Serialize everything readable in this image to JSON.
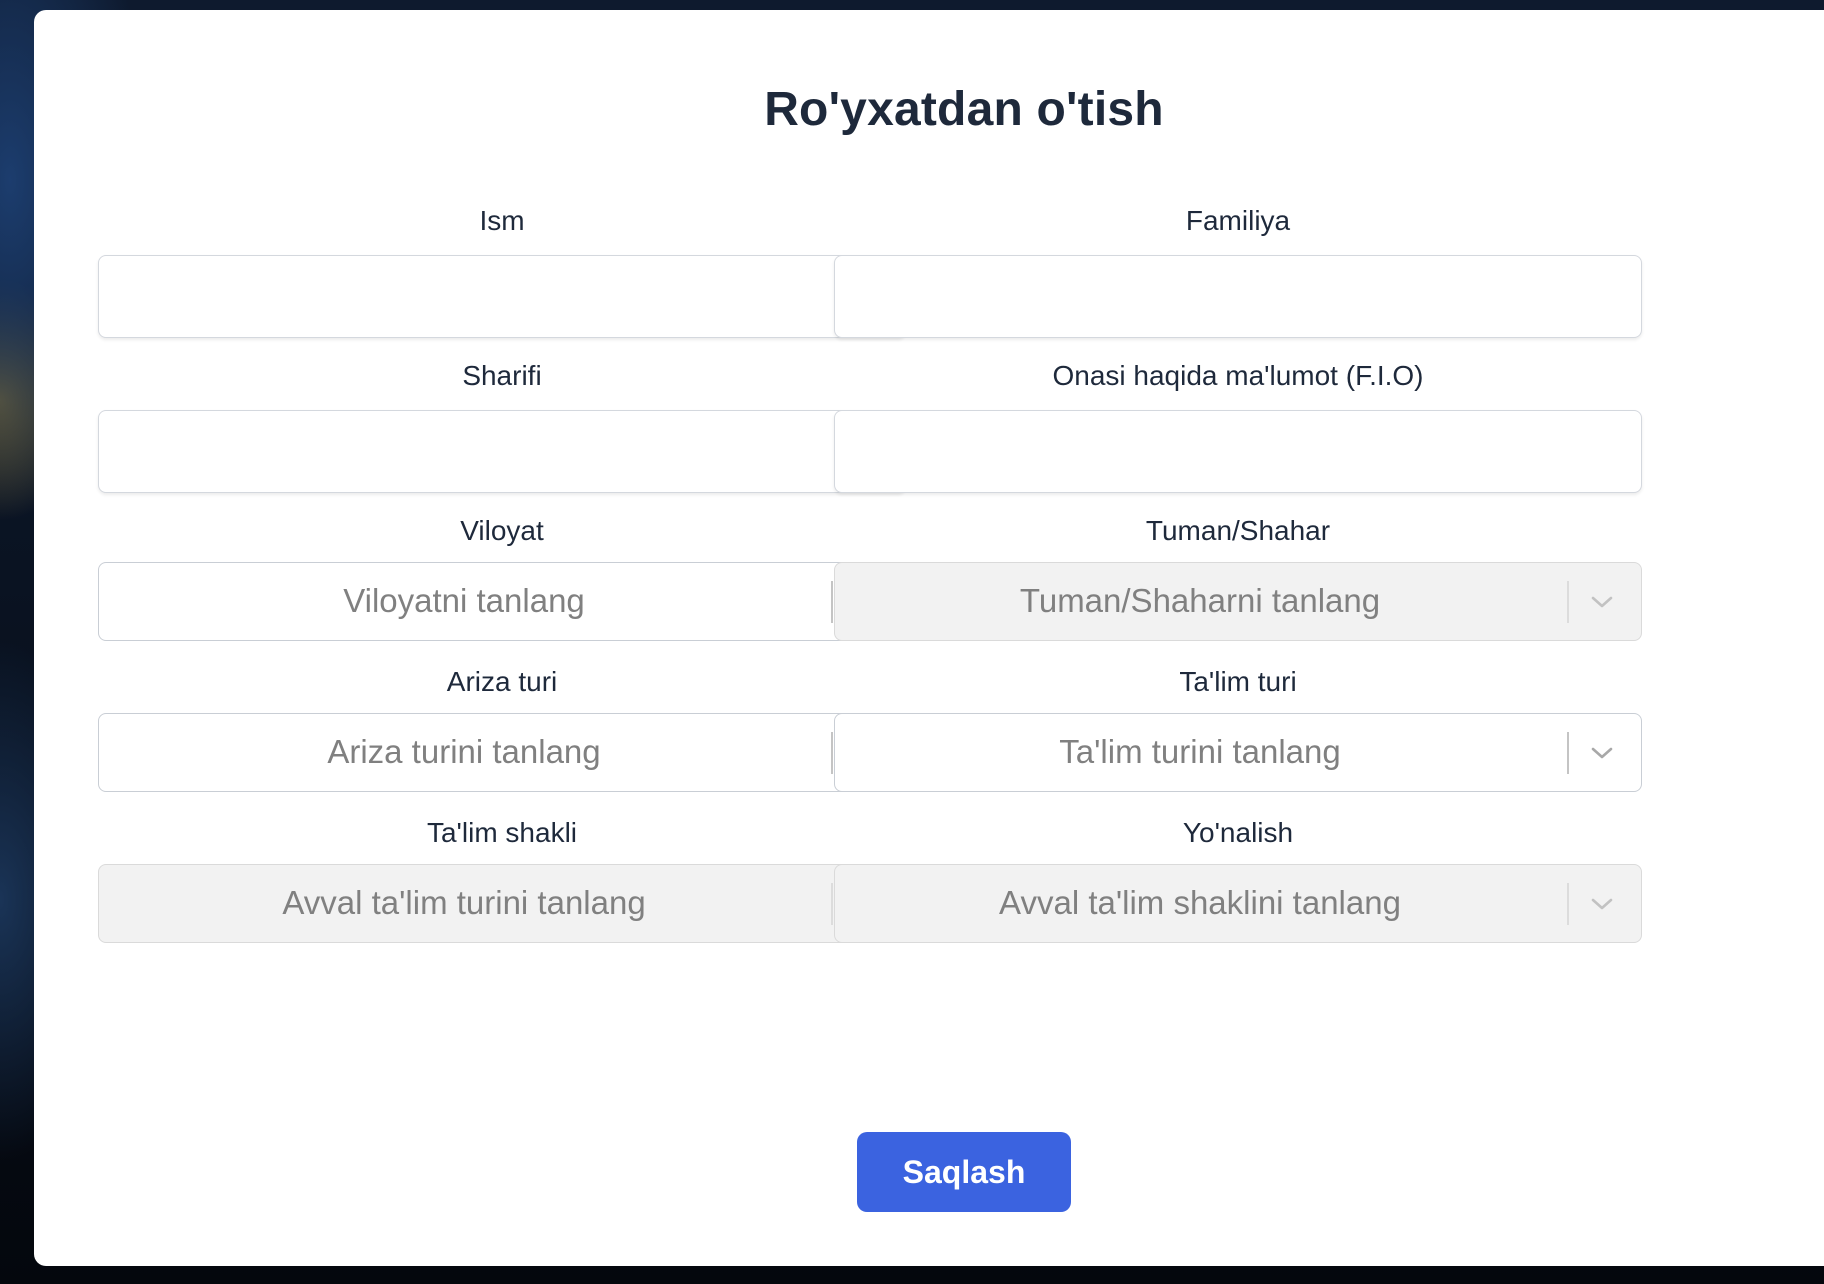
{
  "form": {
    "title": "Ro'yxatdan o'tish",
    "fields": {
      "ism": {
        "label": "Ism",
        "value": ""
      },
      "familiya": {
        "label": "Familiya",
        "value": ""
      },
      "sharifi": {
        "label": "Sharifi",
        "value": ""
      },
      "onasi": {
        "label": "Onasi haqida ma'lumot (F.I.O)",
        "value": ""
      }
    },
    "selects": {
      "viloyat": {
        "label": "Viloyat",
        "placeholder": "Viloyatni tanlang",
        "disabled": false
      },
      "tuman": {
        "label": "Tuman/Shahar",
        "placeholder": "Tuman/Shaharni tanlang",
        "disabled": true
      },
      "ariza": {
        "label": "Ariza turi",
        "placeholder": "Ariza turini tanlang",
        "disabled": false
      },
      "talim_turi": {
        "label": "Ta'lim turi",
        "placeholder": "Ta'lim turini tanlang",
        "disabled": false
      },
      "talim_shakli": {
        "label": "Ta'lim shakli",
        "placeholder": "Avval ta'lim turini tanlang",
        "disabled": true
      },
      "yonalish": {
        "label": "Yo'nalish",
        "placeholder": "Avval ta'lim shaklini tanlang",
        "disabled": true
      }
    },
    "submit_label": "Saqlash"
  },
  "colors": {
    "primary": "#3b63e0",
    "text": "#1e293b",
    "placeholder": "#808080",
    "disabled_bg": "#f2f2f2",
    "page_bg": "#080d18"
  },
  "icons": {
    "select_indicator": "chevron-down-icon"
  }
}
